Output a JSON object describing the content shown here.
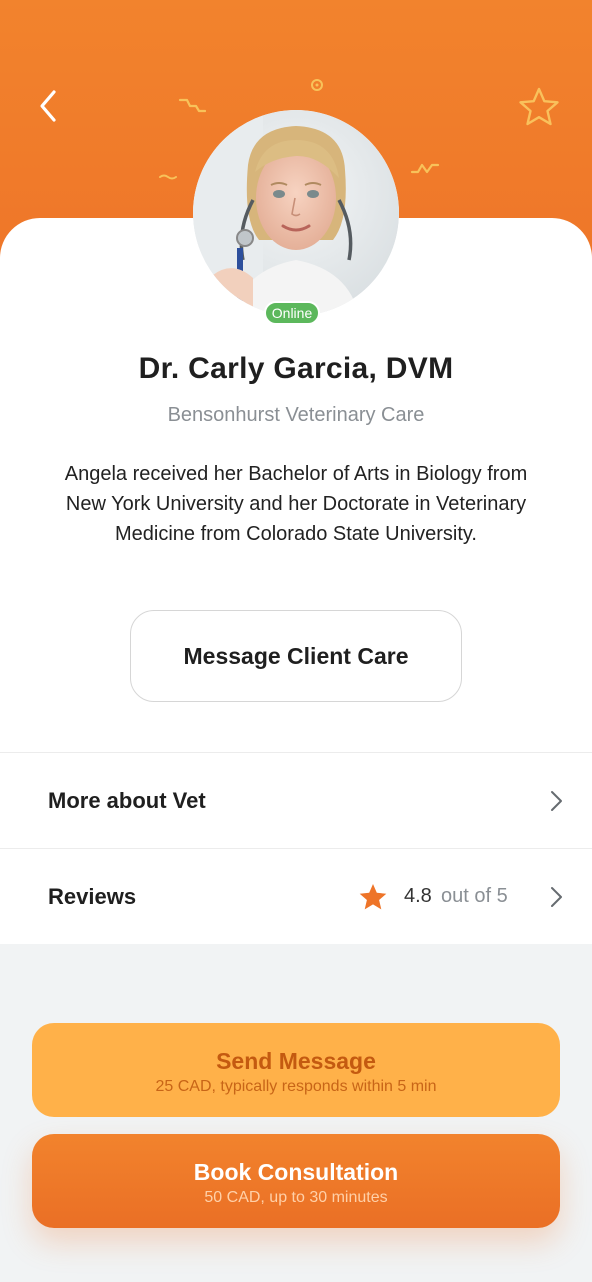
{
  "colors": {
    "accent": "#EE7428",
    "online": "#5CB85C",
    "send_button": "#FFB149"
  },
  "header": {
    "back_icon": "chevron-left-icon",
    "favorite_icon": "star-outline-icon"
  },
  "profile": {
    "status": "Online",
    "name": "Dr. Carly Garcia, DVM",
    "clinic": "Bensonhurst Veterinary Care",
    "bio": "Angela received her Bachelor of Arts in Biology from New York University and her Doctorate in Veterinary Medicine from Colorado State University.",
    "message_button": "Message Client Care"
  },
  "menu": {
    "more_about": "More about Vet",
    "reviews": "Reviews",
    "rating_value": "4.8",
    "rating_suffix": "out of 5",
    "rating": 4.8
  },
  "actions": {
    "send": {
      "title": "Send Message",
      "subtitle": "25 CAD, typically responds within 5 min"
    },
    "book": {
      "title": "Book Consultation",
      "subtitle": "50 CAD, up to 30 minutes"
    }
  }
}
